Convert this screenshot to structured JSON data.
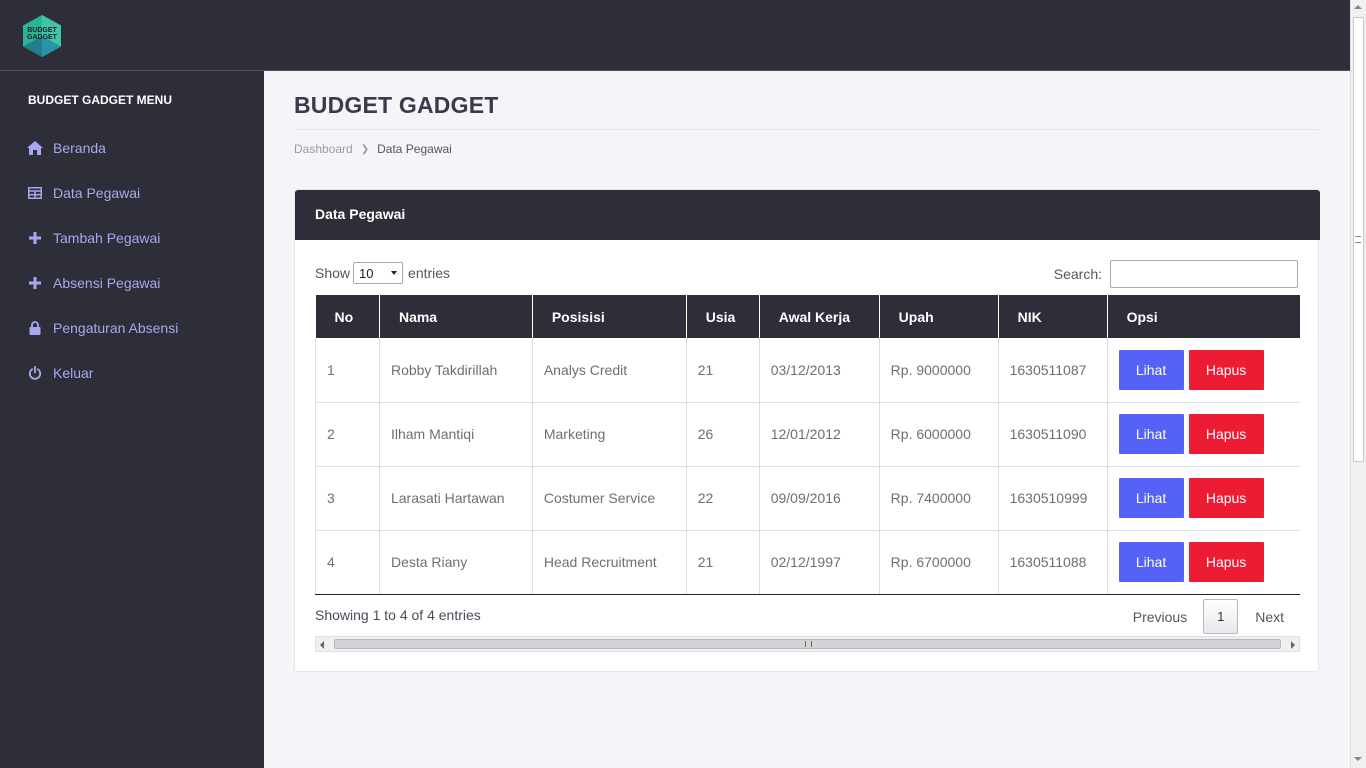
{
  "brand": {
    "logo_text_line1": "BUDGET",
    "logo_text_line2": "GADGET"
  },
  "sidebar": {
    "title": "BUDGET GADGET MENU",
    "items": [
      {
        "label": "Beranda",
        "icon": "home-icon"
      },
      {
        "label": "Data Pegawai",
        "icon": "table-icon"
      },
      {
        "label": "Tambah Pegawai",
        "icon": "plus-icon"
      },
      {
        "label": "Absensi Pegawai",
        "icon": "plus-icon"
      },
      {
        "label": "Pengaturan Absensi",
        "icon": "lock-icon"
      },
      {
        "label": "Keluar",
        "icon": "power-icon"
      }
    ]
  },
  "main": {
    "page_title": "BUDGET GADGET",
    "breadcrumb": [
      "Dashboard",
      "Data Pegawai"
    ]
  },
  "card": {
    "title": "Data Pegawai",
    "show_label": "Show",
    "entries_label": "entries",
    "page_length": "10",
    "search_label": "Search:",
    "search_value": "",
    "columns": [
      "No",
      "Nama",
      "Posisisi",
      "Usia",
      "Awal Kerja",
      "Upah",
      "NIK",
      "Opsi"
    ],
    "rows": [
      [
        "1",
        "Robby Takdirillah",
        "Analys Credit",
        "21",
        "03/12/2013",
        "Rp. 9000000",
        "1630511087"
      ],
      [
        "2",
        "Ilham Mantiqi",
        "Marketing",
        "26",
        "12/01/2012",
        "Rp. 6000000",
        "1630511090"
      ],
      [
        "3",
        "Larasati Hartawan",
        "Costumer Service",
        "22",
        "09/09/2016",
        "Rp. 7400000",
        "1630510999"
      ],
      [
        "4",
        "Desta Riany",
        "Head Recruitment",
        "21",
        "02/12/1997",
        "Rp. 6700000",
        "1630511088"
      ]
    ],
    "view_label": "Lihat",
    "delete_label": "Hapus",
    "showing_text": "Showing 1 to 4 of 4 entries",
    "pager": {
      "previous": "Previous",
      "current": "1",
      "next": "Next"
    }
  },
  "colors": {
    "dark": "#2e2e38",
    "menu_text": "#a7a9f0",
    "view_button": "#5562f5",
    "delete_button": "#ee1b34",
    "background": "#f4f5f8",
    "logo_teal": "#2bb39a"
  }
}
